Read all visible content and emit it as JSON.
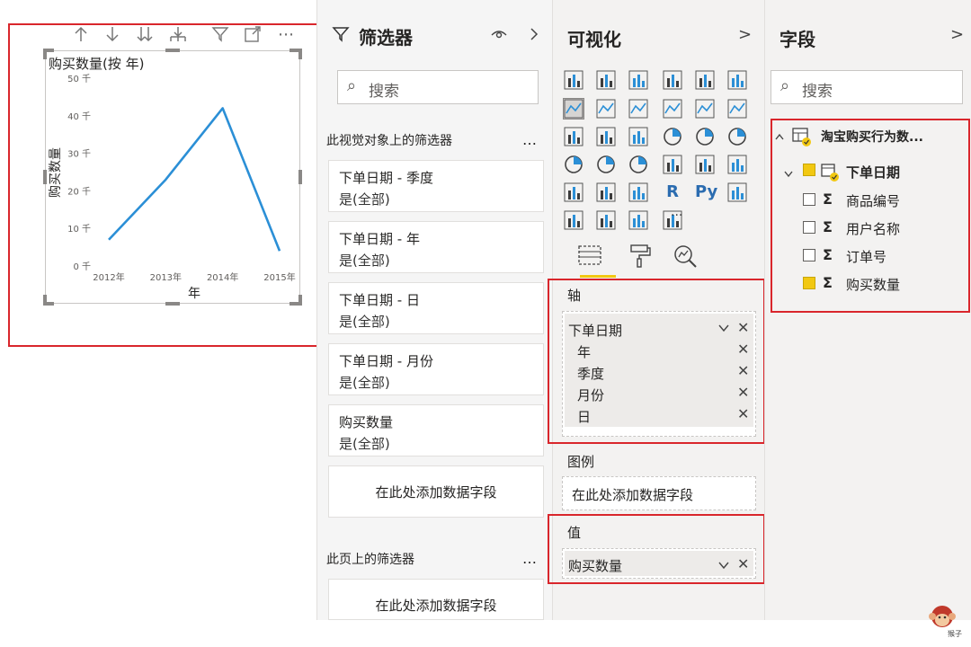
{
  "toolbar": {
    "icons": [
      "arrow-up-icon",
      "arrow-down-icon",
      "double-arrow-down-icon",
      "expand-hierarchy-icon",
      "filter-icon",
      "focus-mode-icon",
      "more-options-icon"
    ],
    "more_glyph": "⋯"
  },
  "chart_data": {
    "type": "line",
    "title": "购买数量(按 年)",
    "xlabel": "年",
    "ylabel": "购买数量",
    "categories": [
      "2012年",
      "2013年",
      "2014年",
      "2015年"
    ],
    "series": [
      {
        "values": [
          7,
          23,
          42,
          4
        ]
      }
    ],
    "yticks": [
      "0 千",
      "10 千",
      "20 千",
      "30 千",
      "40 千",
      "50 千"
    ],
    "ylim": [
      0,
      50
    ],
    "line_color": "#2b8fd6"
  },
  "filters_pane": {
    "title": "筛选器",
    "search_placeholder": "搜索",
    "section_visual": "此视觉对象上的筛选器",
    "section_page": "此页上的筛选器",
    "more": "…",
    "cards": [
      {
        "title": "下单日期 - 季度",
        "value": "是(全部)"
      },
      {
        "title": "下单日期 - 年",
        "value": "是(全部)"
      },
      {
        "title": "下单日期 - 日",
        "value": "是(全部)"
      },
      {
        "title": "下单日期 - 月份",
        "value": "是(全部)"
      },
      {
        "title": "购买数量",
        "value": "是(全部)"
      }
    ],
    "add_field": "在此处添加数据字段",
    "add_field_page": "在此处添加数据字段"
  },
  "viz_pane": {
    "title": "可视化",
    "chevron": ">",
    "more": "···",
    "r_label": "R",
    "py_label": "Py",
    "axis_label": "轴",
    "axis_field": "下单日期",
    "axis_items": [
      "年",
      "季度",
      "月份",
      "日"
    ],
    "legend_label": "图例",
    "legend_placeholder": "在此处添加数据字段",
    "values_label": "值",
    "values_field": "购买数量"
  },
  "fields_pane": {
    "title": "字段",
    "chevron": ">",
    "search_placeholder": "搜索",
    "table_name": "淘宝购买行为数...",
    "date_field": "下单日期",
    "fields": [
      {
        "label": "商品编号",
        "checked": false
      },
      {
        "label": "用户名称",
        "checked": false
      },
      {
        "label": "订单号",
        "checked": false
      },
      {
        "label": "购买数量",
        "checked": true
      }
    ],
    "sigma": "Σ"
  },
  "watermark": {
    "text": "猴子"
  }
}
